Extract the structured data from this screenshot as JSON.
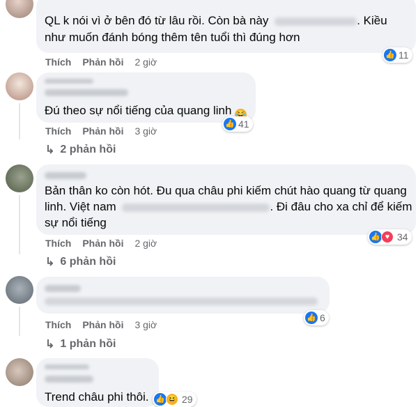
{
  "comments": [
    {
      "line1_a": "QL k nói vì ở bên đó từ lâu rồi. Còn bà này",
      "line1_b": ". Kiều",
      "line2": "như muốn đánh bóng thêm tên tuổi thì đúng hơn",
      "like": "Thích",
      "reply": "Phản hồi",
      "time": "2 giờ",
      "reaction_count": "11"
    },
    {
      "text": "Đú theo sự nổi tiếng của quang linh",
      "emoji": "rolling-on-floor-laughing",
      "like": "Thích",
      "reply": "Phản hồi",
      "time": "3 giờ",
      "reaction_count": "41",
      "replies_label": "2 phản hồi"
    },
    {
      "line1": "Bản thân ko còn hót. Đu qua châu phi kiếm chút hào quang từ quang",
      "line2_a": "linh. Việt nam",
      "line2_b": ". Đi đâu cho xa chỉ để kiếm",
      "line3": "sự nổi tiếng",
      "like": "Thích",
      "reply": "Phản hồi",
      "time": "2 giờ",
      "reaction_count": "34",
      "replies_label": "6 phản hồi"
    },
    {
      "like": "Thích",
      "reply": "Phản hồi",
      "time": "3 giờ",
      "reaction_count": "6",
      "replies_label": "1 phản hồi"
    },
    {
      "text": "Trend châu phi thôi.",
      "reaction_count": "29"
    }
  ],
  "icons": {
    "like": "like-icon",
    "love": "love-icon",
    "haha": "haha-icon",
    "reply_arrow": "reply-arrow-icon"
  },
  "colors": {
    "bubble": "#f0f2f5",
    "like_blue": "#1877f2",
    "love_red": "#f33e58",
    "haha_yellow": "#f7b125",
    "meta_gray": "#65676b"
  }
}
